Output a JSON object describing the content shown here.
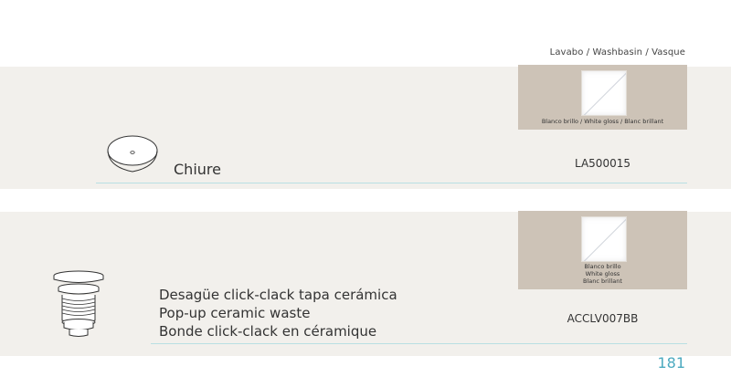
{
  "header": {
    "category_label": "Lavabo / Washbasin / Vasque"
  },
  "products": [
    {
      "name": "Chiure",
      "icon": "oval-washbasin-icon",
      "finish": "Blanco brillo / White gloss / Blanc brillant",
      "code": "LA500015"
    },
    {
      "description_lines": [
        "Desagüe click-clack tapa cerámica",
        "Pop-up ceramic waste",
        "Bonde click-clack en céramique"
      ],
      "icon": "popup-waste-icon",
      "finish_lines": [
        "Blanco brillo",
        "White gloss",
        "Blanc brillant"
      ],
      "code": "ACCLV007BB"
    }
  ],
  "page_number": "181",
  "colors": {
    "band": "#f2f0ec",
    "swatch": "#cdc3b7",
    "accent": "#4ba9bf",
    "rule": "#b9dfe3"
  }
}
